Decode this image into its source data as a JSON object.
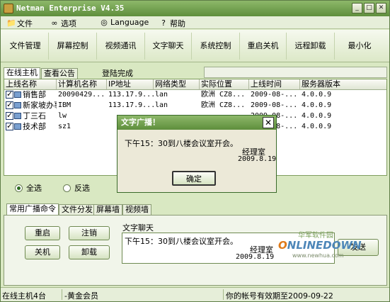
{
  "window": {
    "title": "Netman Enterprise V4.35",
    "min_glyph": "_",
    "max_glyph": "□",
    "close_glyph": "✕"
  },
  "menu": [
    {
      "label": "文件",
      "icon": "file-icon"
    },
    {
      "label": "选项",
      "icon": "glasses-icon"
    },
    {
      "label": "Language",
      "icon": "globe-icon"
    },
    {
      "label": "帮助",
      "icon": "help-icon"
    }
  ],
  "toolbar": [
    "文件管理",
    "屏幕控制",
    "视频通讯",
    "文字聊天",
    "系统控制",
    "重启关机",
    "远程卸载",
    "最小化"
  ],
  "top_tabs": [
    "在线主机",
    "查看公告"
  ],
  "login_status": "登陆完成",
  "grid": {
    "headers": [
      "上线名称",
      "计算机名称",
      "IP地址",
      "网络类型",
      "实际位置",
      "上线时间",
      "服务器版本"
    ],
    "rows": [
      [
        "销售部",
        "20090429...",
        "113.17.9...",
        "lan",
        "欧洲 CZ8...",
        "2009-08-...",
        "4.0.0.9"
      ],
      [
        "新家坡办事处",
        "IBM",
        "113.17.9...",
        "lan",
        "欧洲 CZ8...",
        "2009-08-...",
        "4.0.0.9"
      ],
      [
        "丁三石",
        "lw",
        "",
        "",
        "",
        "2009-08-...",
        "4.0.0.9"
      ],
      [
        "技术部",
        "sz1",
        "",
        "",
        "",
        "2009-08-...",
        "4.0.0.9"
      ]
    ]
  },
  "select_all": "全选",
  "invert_select": "反选",
  "bottom_tabs": [
    "常用广播命令",
    "文件分发",
    "屏幕墙",
    "视频墙"
  ],
  "buttons": {
    "restart": "重启",
    "logoff": "注销",
    "shutdown": "关机",
    "uninstall": "卸载",
    "send": "发送"
  },
  "chat": {
    "label": "文字聊天",
    "message": "下午15：30到八楼会议室开会。",
    "signature": "经理室",
    "date": "2009.8.19"
  },
  "dialog": {
    "title": "文字广播！",
    "message": "下午15：30到八楼会议室开会。",
    "signature": "经理室",
    "date": "2009.8.19",
    "ok": "确定"
  },
  "statusbar": {
    "online_count": "在线主机4台",
    "member": "-黄金会员",
    "expiry": "你的帐号有效期至2009-09-22"
  },
  "watermark": {
    "cn": "华军软件园",
    "en": "NLINEDOWN",
    "url": "www.newhua.com"
  }
}
